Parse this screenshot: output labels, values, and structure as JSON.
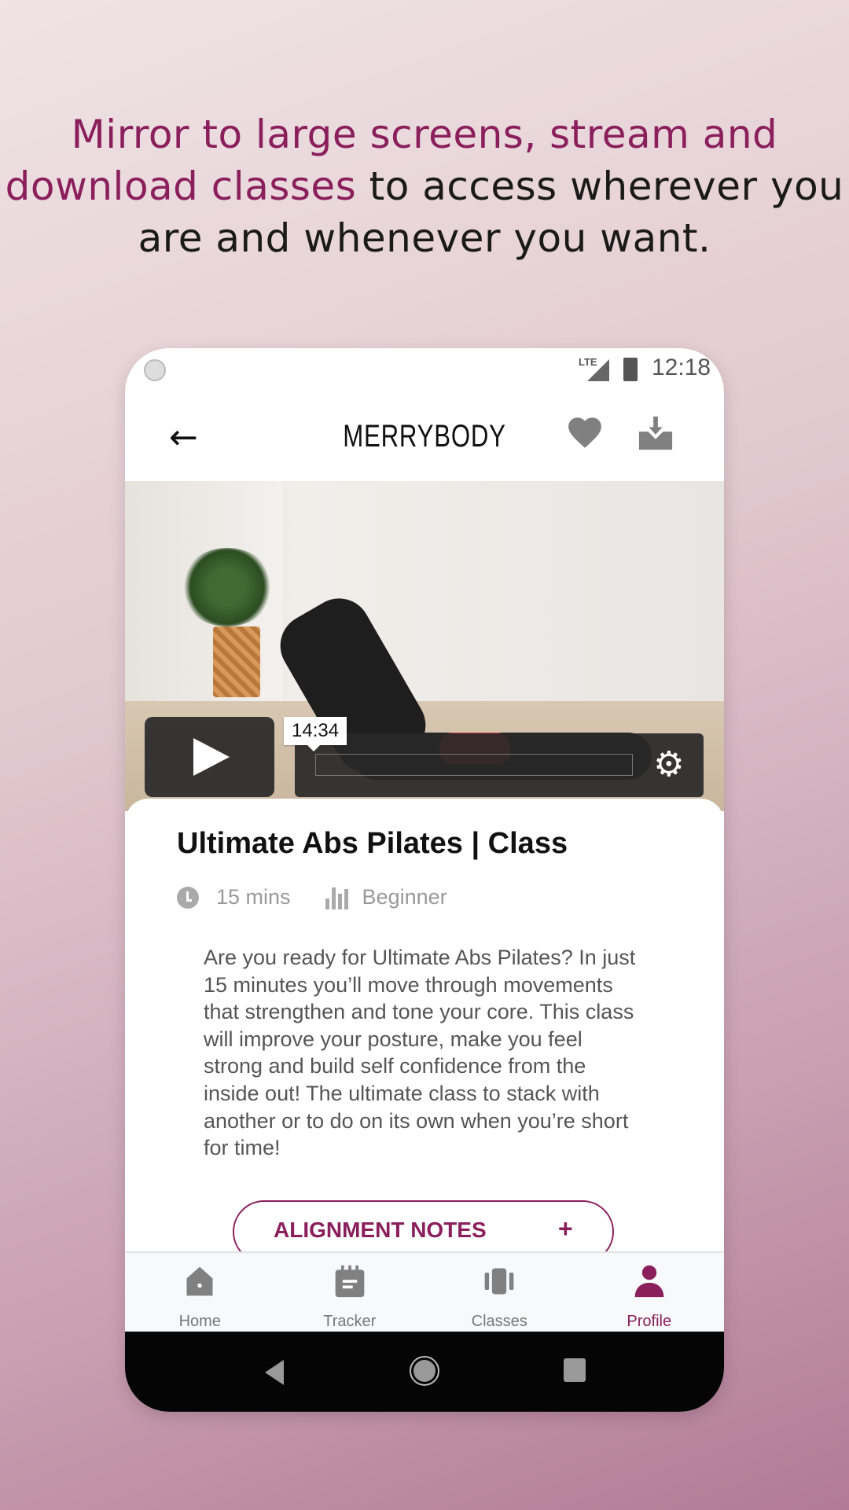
{
  "headline": {
    "accent": "Mirror to large screens, stream and download classes",
    "rest": " to access wherever you are and whenever you want."
  },
  "status": {
    "network": "LTE",
    "time": "12:18"
  },
  "appbar": {
    "brand": "MERRYBODY",
    "icons": [
      "arrow-left-icon",
      "heart-icon",
      "download-icon"
    ]
  },
  "player": {
    "tooltip_time": "14:34",
    "progress": 0
  },
  "class": {
    "title": "Ultimate Abs Pilates | Class",
    "duration": "15 mins",
    "level": "Beginner",
    "description": "Are you ready for Ultimate Abs Pilates? In just 15 minutes you’ll move through movements that strengthen and tone your core. This class will improve your posture, make you feel strong and build self confidence from the inside out! The ultimate class to stack with another or to do on its own when you’re short for time!",
    "alignment_label": "ALIGNMENT NOTES",
    "alignment_icon": "+"
  },
  "nav": {
    "items": [
      {
        "label": "Home",
        "icon": "home-icon"
      },
      {
        "label": "Tracker",
        "icon": "calendar-icon"
      },
      {
        "label": "Classes",
        "icon": "video-carousel-icon"
      },
      {
        "label": "Profile",
        "icon": "person-icon",
        "active": true
      }
    ]
  },
  "colors": {
    "accent": "#8a1f5c",
    "icon_gray": "#808080"
  }
}
